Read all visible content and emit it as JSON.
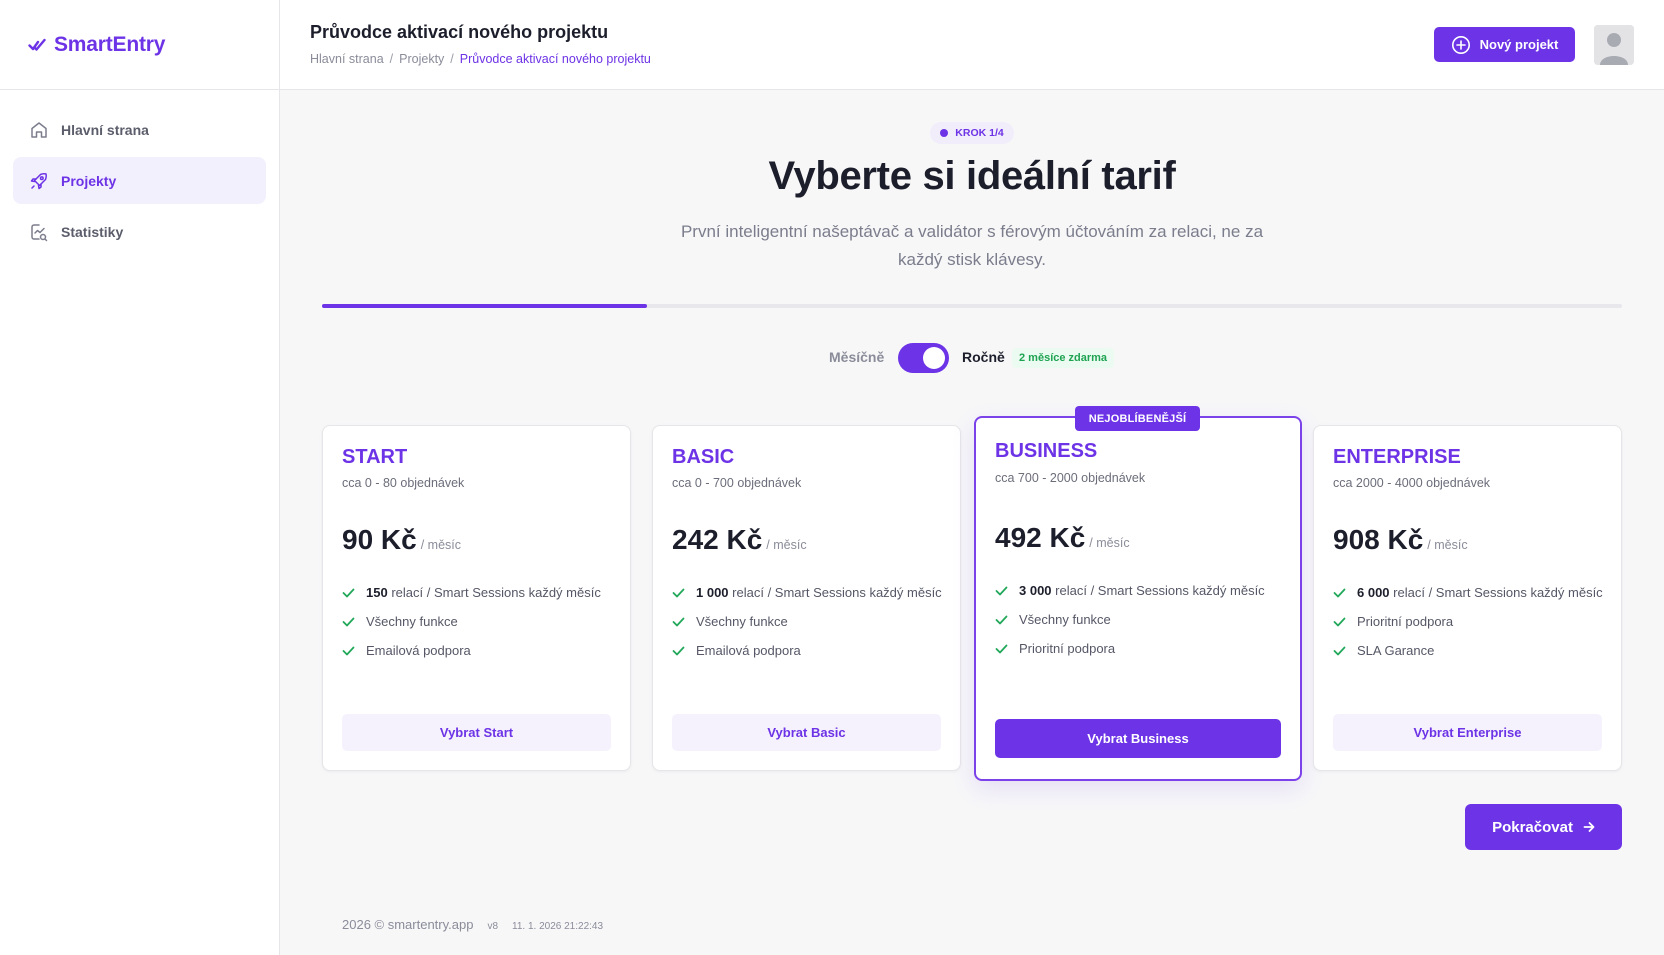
{
  "app": {
    "name": "SmartEntry",
    "brand_color": "#6d33e6",
    "success_color": "#1fa352"
  },
  "sidebar": {
    "items": [
      {
        "label": "Hlavní strana",
        "icon": "home-icon",
        "active": false
      },
      {
        "label": "Projekty",
        "icon": "rocket-icon",
        "active": true
      },
      {
        "label": "Statistiky",
        "icon": "chart-icon",
        "active": false
      }
    ]
  },
  "header": {
    "title": "Průvodce aktivací nového projektu",
    "breadcrumb": [
      "Hlavní strana",
      "Projekty",
      "Průvodce aktivací nového projektu"
    ],
    "breadcrumb_sep": "/",
    "new_project_label": "Nový projekt"
  },
  "wizard": {
    "step_label": "KROK 1/4",
    "step_progress": 0.25,
    "title": "Vyberte si ideální tarif",
    "subtitle": "První inteligentní našeptávač a validátor s férovým účtováním za relaci, ne za každý stisk klávesy."
  },
  "billing": {
    "monthly_label": "Měsíčně",
    "yearly_label": "Ročně",
    "yearly_selected": true,
    "yearly_note": "2 měsíce zdarma"
  },
  "plans": [
    {
      "name": "START",
      "orders": "cca 0 - 80 objednávek",
      "price": "90 Kč",
      "per": "/ měsíc",
      "sessions_bold": "150",
      "sessions_text": "relací / Smart Sessions každý měsíc",
      "features": [
        "Všechny funkce",
        "Emailová podpora"
      ],
      "button": "Vybrat Start",
      "featured": false
    },
    {
      "name": "BASIC",
      "orders": "cca 0 - 700 objednávek",
      "price": "242 Kč",
      "per": "/ měsíc",
      "sessions_bold": "1 000",
      "sessions_text": "relací / Smart Sessions každý měsíc",
      "features": [
        "Všechny funkce",
        "Emailová podpora"
      ],
      "button": "Vybrat Basic",
      "featured": false
    },
    {
      "name": "BUSINESS",
      "orders": "cca 700 - 2000 objednávek",
      "price": "492 Kč",
      "per": "/ měsíc",
      "sessions_bold": "3 000",
      "sessions_text": "relací / Smart Sessions každý měsíc",
      "features": [
        "Všechny funkce",
        "Prioritní podpora"
      ],
      "button": "Vybrat Business",
      "featured": true
    },
    {
      "name": "ENTERPRISE",
      "orders": "cca 2000 - 4000 objednávek",
      "price": "908 Kč",
      "per": "/ měsíc",
      "sessions_bold": "6 000",
      "sessions_text": "relací / Smart Sessions každý měsíc",
      "features": [
        "Prioritní podpora",
        "SLA Garance"
      ],
      "button": "Vybrat Enterprise",
      "featured": false
    }
  ],
  "popular_badge": "NEJOBLÍBENĚJŠÍ",
  "continue_label": "Pokračovat",
  "footer": {
    "copyright": "2026 © smartentry.app",
    "version": "v8",
    "timestamp": "11. 1. 2026 21:22:43"
  }
}
